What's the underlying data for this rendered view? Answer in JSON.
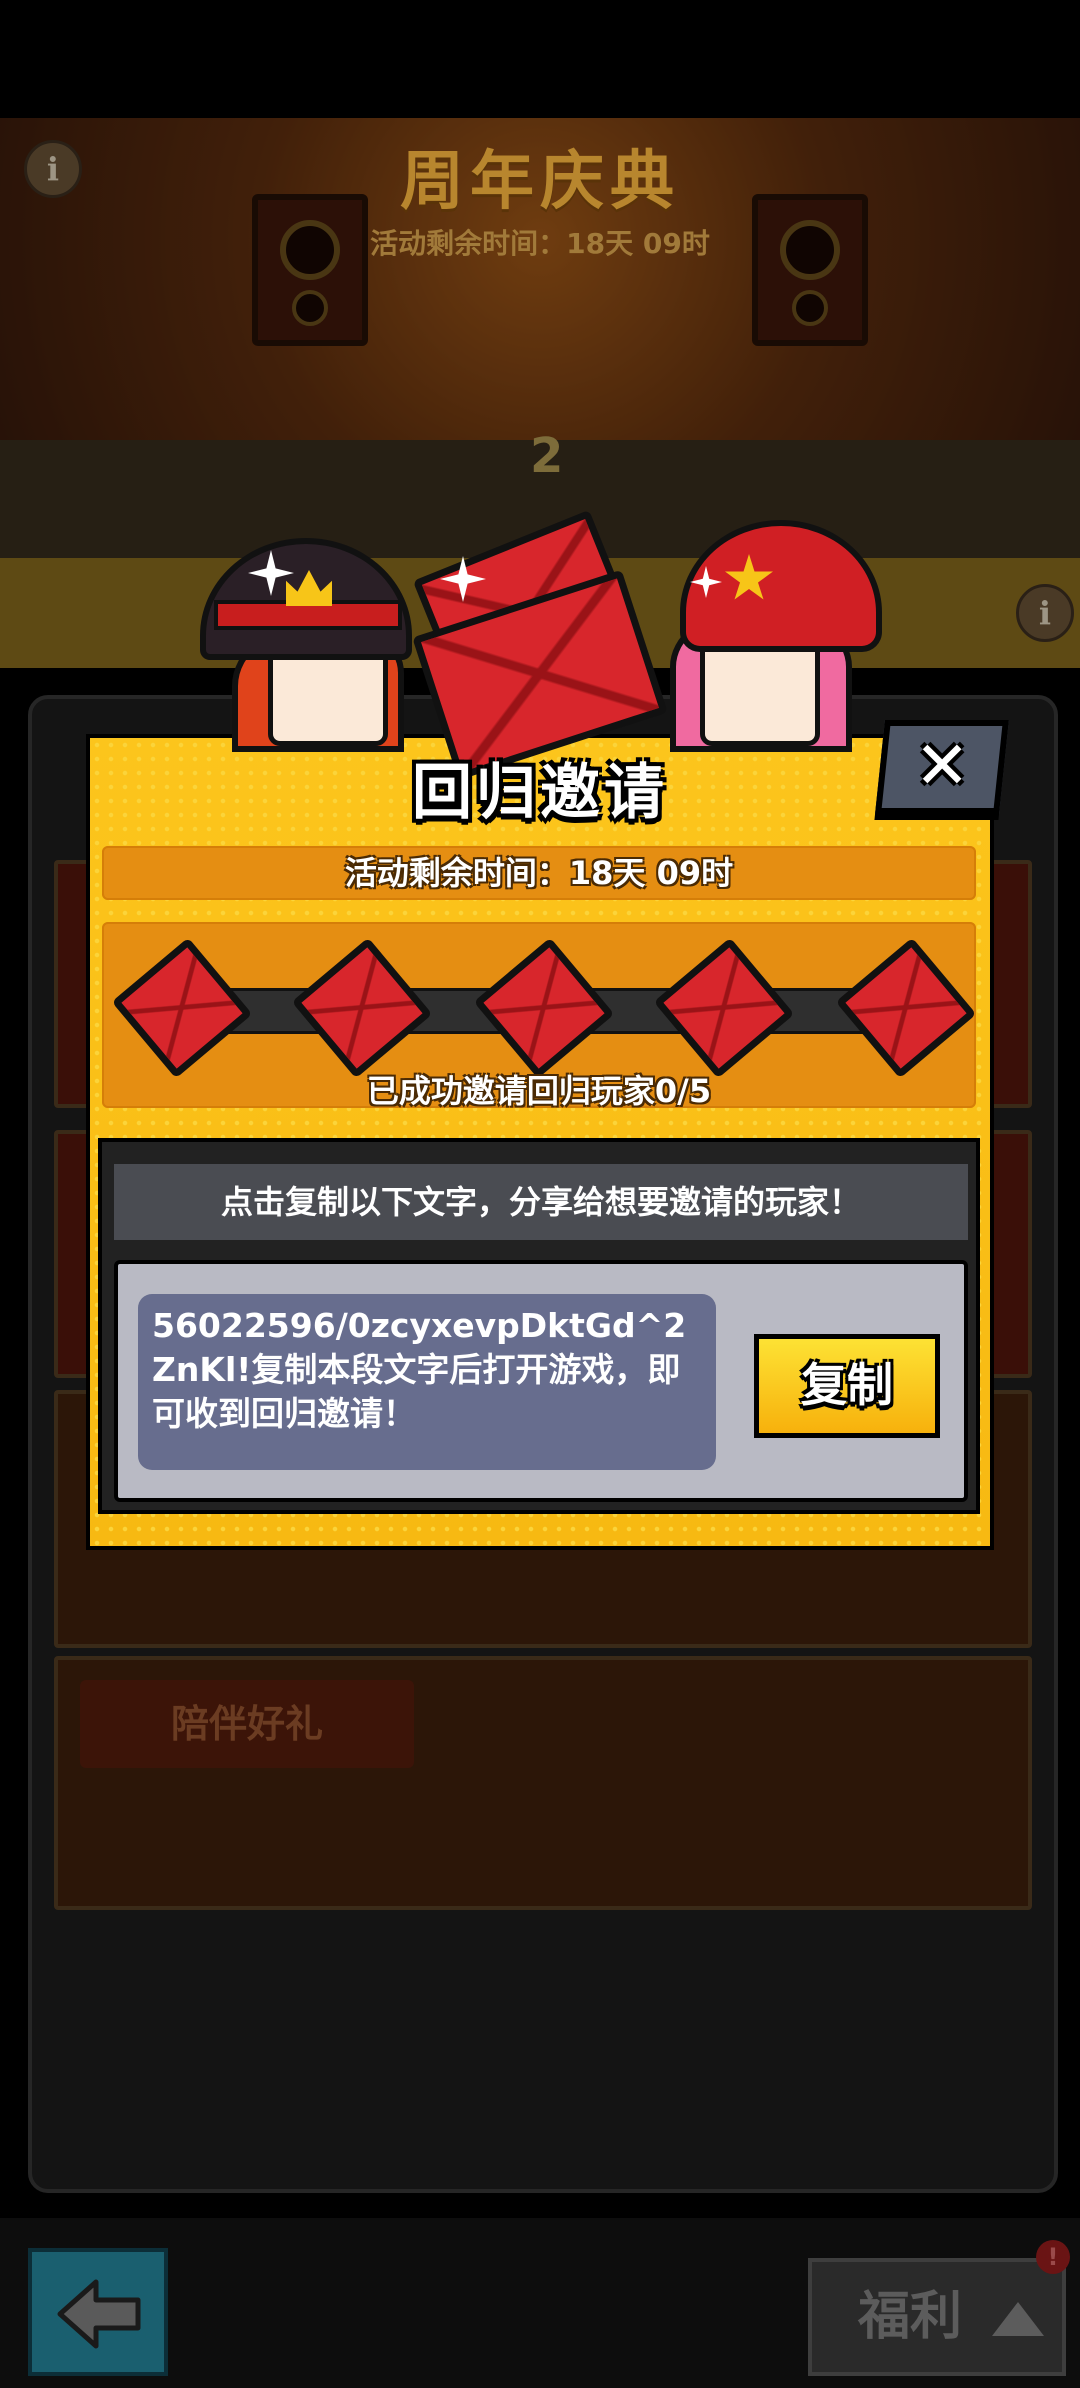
{
  "background": {
    "banner_title": "周年庆典",
    "banner_subtitle": "活动剩余时间：18天 09时",
    "stage_number": "2",
    "card_label": "陪伴好礼",
    "welfare_label": "福利",
    "badge": "!"
  },
  "modal": {
    "title": "回归邀请",
    "close_label": "✕",
    "timer": "活动剩余时间：18天 09时",
    "progress": {
      "invited": 0,
      "total": 5,
      "label": "已成功邀请回归玩家0/5"
    },
    "share_header": "点击复制以下文字，分享给想要邀请的玩家！",
    "share_text": "56022596/0zcyxevpDktGd^2ZnKl!复制本段文字后打开游戏，即可收到回归邀请！",
    "copy_label": "复制"
  },
  "colors": {
    "modal_yellow": "#fcc51c",
    "bar_orange": "#e58e12",
    "envelope_red": "#d8262c",
    "close_button": "#4d5565",
    "code_box": "#676d8e"
  },
  "icons": [
    "info-icon",
    "close-icon",
    "envelope-icon",
    "back-arrow-icon",
    "chevron-up-icon"
  ]
}
